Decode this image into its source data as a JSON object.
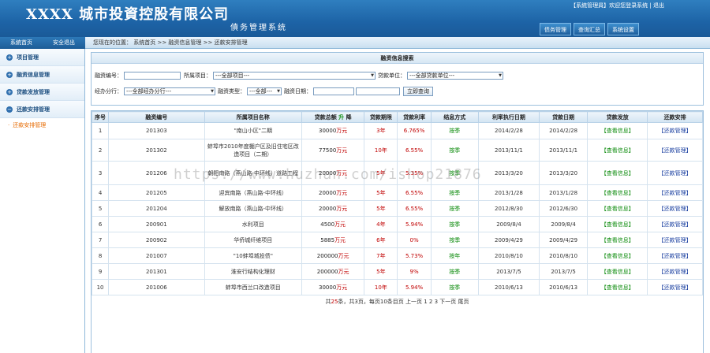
{
  "header": {
    "title": "XXXX 城市投資控股有限公司",
    "subtitle": "債务管理系统",
    "user_text": "【系統管理員】欢迎您登录系统",
    "logout_label": "退出",
    "tabs": [
      "债务管理",
      "查询汇总",
      "系统设置"
    ]
  },
  "nav": {
    "left_buttons": [
      "系統首页",
      "安全退出"
    ],
    "breadcrumb": "您现在的位置： 系统首页 >> 融资信息管理 >> 还款安排管理"
  },
  "sidebar": {
    "items": [
      {
        "label": "项目管理"
      },
      {
        "label": "融资信息管理"
      },
      {
        "label": "贷款发放管理"
      },
      {
        "label": "还款安排管理"
      }
    ],
    "sub_item": "还款安排管理"
  },
  "search": {
    "title": "融资信息搜索",
    "code_label": "融资编号：",
    "project_label": "所属项目：",
    "project_value": "---全部项目---",
    "lender_label": "贷款单位：",
    "lender_value": "---全部贷款单位---",
    "branch_label": "经办分行：",
    "branch_value": "---全部经办分行---",
    "type_label": "融资类型：",
    "type_value": "---全部---",
    "date_label": "融资日期：",
    "search_button": "立即查询"
  },
  "table": {
    "headers": [
      "序号",
      "融资编号",
      "所属项目名称",
      "贷款总额",
      "升",
      "降",
      "贷款期限",
      "贷款利率",
      "结息方式",
      "利率执行日期",
      "贷款日期",
      "贷款发放",
      "还款安排"
    ],
    "rows": [
      {
        "no": "1",
        "code": "201303",
        "project": "\"南山小区\"二期",
        "amount": "30000",
        "term": "3年",
        "rate": "6.765%",
        "method": "按季",
        "rate_date": "2014/2/28",
        "loan_date": "2014/2/28",
        "release": "【查看信息】",
        "repay": "【还款管理】"
      },
      {
        "no": "2",
        "code": "201302",
        "project": "蚌埠市2010年度棚户区及旧住宅区改造项目（二期）",
        "amount": "77500",
        "term": "10年",
        "rate": "6.55%",
        "method": "按季",
        "rate_date": "2013/11/1",
        "loan_date": "2013/11/1",
        "release": "【查看信息】",
        "repay": "【还款管理】"
      },
      {
        "no": "3",
        "code": "201206",
        "project": "朝阳南路（燕山路-中环线）道路工程",
        "amount": "20000",
        "term": "5年",
        "rate": "5.35%",
        "method": "按季",
        "rate_date": "2013/3/20",
        "loan_date": "2013/3/20",
        "release": "【查看信息】",
        "repay": "【还款管理】"
      },
      {
        "no": "4",
        "code": "201205",
        "project": "迎宾南路（燕山路-中环线）",
        "amount": "20000",
        "term": "5年",
        "rate": "6.55%",
        "method": "按季",
        "rate_date": "2013/1/28",
        "loan_date": "2013/1/28",
        "release": "【查看信息】",
        "repay": "【还款管理】"
      },
      {
        "no": "5",
        "code": "201204",
        "project": "解放南路（燕山路-中环线）",
        "amount": "20000",
        "term": "5年",
        "rate": "6.55%",
        "method": "按季",
        "rate_date": "2012/8/30",
        "loan_date": "2012/6/30",
        "release": "【查看信息】",
        "repay": "【还款管理】"
      },
      {
        "no": "6",
        "code": "200901",
        "project": "水利项目",
        "amount": "4500",
        "term": "4年",
        "rate": "5.94%",
        "method": "按季",
        "rate_date": "2009/8/4",
        "loan_date": "2009/8/4",
        "release": "【查看信息】",
        "repay": "【还款管理】"
      },
      {
        "no": "7",
        "code": "200902",
        "project": "华侨城纤维项目",
        "amount": "5885",
        "term": "6年",
        "rate": "0%",
        "method": "按季",
        "rate_date": "2009/4/29",
        "loan_date": "2009/4/29",
        "release": "【查看信息】",
        "repay": "【还款管理】"
      },
      {
        "no": "8",
        "code": "201007",
        "project": "\"10蚌埠城投债\"",
        "amount": "200000",
        "term": "7年",
        "rate": "5.73%",
        "method": "按年",
        "rate_date": "2010/8/10",
        "loan_date": "2010/8/10",
        "release": "【查看信息】",
        "repay": "【还款管理】"
      },
      {
        "no": "9",
        "code": "201301",
        "project": "淮安行结构化理财",
        "amount": "200000",
        "term": "5年",
        "rate": "9%",
        "method": "按季",
        "rate_date": "2013/7/5",
        "loan_date": "2013/7/5",
        "release": "【查看信息】",
        "repay": "【还款管理】"
      },
      {
        "no": "10",
        "code": "201006",
        "project": "蚌埠市西兰口改造项目",
        "amount": "30000",
        "term": "10年",
        "rate": "5.94%",
        "method": "按季",
        "rate_date": "2010/6/13",
        "loan_date": "2010/6/13",
        "release": "【查看信息】",
        "repay": "【还款管理】"
      }
    ],
    "unit": "万元"
  },
  "pager": {
    "prefix": "共",
    "total": "25",
    "suffix": "条，共3页，每页10条目页 上一页 1 2 3 下一页 尾页"
  },
  "watermark": "https://www.huzhan.com/ishop21876",
  "colors": {
    "header_blue": "#1d63a6",
    "accent_red": "#c00000",
    "accent_green": "#0a8a0a"
  }
}
